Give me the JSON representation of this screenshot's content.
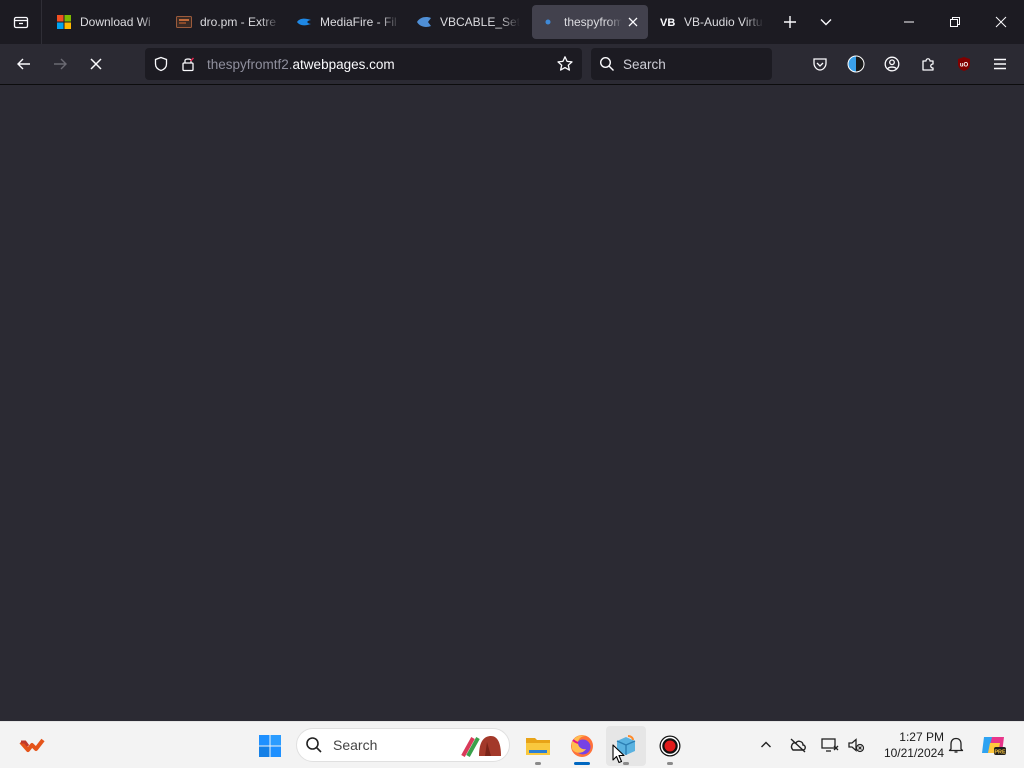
{
  "browser": {
    "tabs": [
      {
        "title": "Download Wi",
        "icon": "windows-logo-icon"
      },
      {
        "title": "dro.pm - Extre",
        "icon": "dropm-icon"
      },
      {
        "title": "MediaFire - Fil",
        "icon": "mediafire-icon"
      },
      {
        "title": "VBCABLE_Setu",
        "icon": "vbcable-icon"
      },
      {
        "title": "thespyfromt",
        "icon": "site-icon",
        "active": true
      },
      {
        "title": "VB-Audio Virtu",
        "icon": "vb-audio-icon"
      }
    ],
    "url_prefix": "thespyfromtf2.",
    "url_domain": "atwebpages.com",
    "search_placeholder": "Search",
    "colors": {
      "chrome": "#1c1b22",
      "toolbar": "#2b2a33",
      "active_tab": "#42414d",
      "content": "#2b2a33"
    }
  },
  "taskbar": {
    "search_label": "Search",
    "time": "1:27 PM",
    "date": "10/21/2024",
    "apps": [
      "file-explorer",
      "firefox",
      "app-store",
      "recorder"
    ]
  }
}
